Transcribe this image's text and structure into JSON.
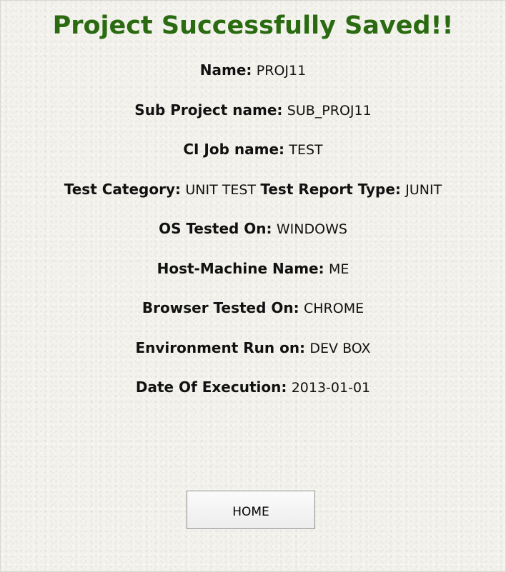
{
  "header": {
    "title": "Project Successfully Saved!!"
  },
  "details": {
    "name": {
      "label": "Name:",
      "value": "PROJ11"
    },
    "sub_project": {
      "label": "Sub Project name:",
      "value": "SUB_PROJ11"
    },
    "ci_job": {
      "label": "CI Job name:",
      "value": "TEST"
    },
    "test_category": {
      "label": "Test Category:",
      "value": "UNIT TEST"
    },
    "test_report_type": {
      "label": "Test Report Type:",
      "value": "JUNIT"
    },
    "os": {
      "label": "OS Tested On:",
      "value": "WINDOWS"
    },
    "host": {
      "label": "Host-Machine Name:",
      "value": "ME"
    },
    "browser": {
      "label": "Browser Tested On:",
      "value": "CHROME"
    },
    "environment": {
      "label": "Environment Run on:",
      "value": "DEV BOX"
    },
    "date": {
      "label": "Date Of Execution:",
      "value": "2013-01-01"
    }
  },
  "actions": {
    "home_label": "HOME"
  },
  "colors": {
    "title": "#2a6a10",
    "background": "#f3f2ec"
  }
}
